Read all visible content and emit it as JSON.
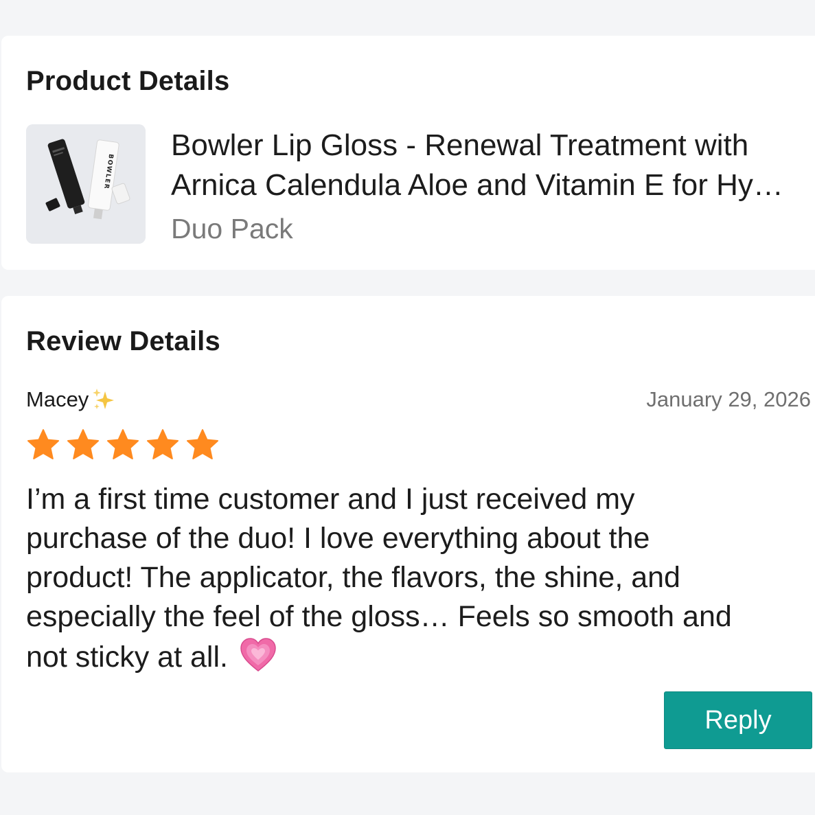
{
  "product_section": {
    "title": "Product Details",
    "product_name_line1": "Bowler Lip Gloss - Renewal Treatment with",
    "product_name_line2": "Arnica Calendula Aloe and Vitamin E for Hy…",
    "variant": "Duo Pack",
    "thumbnail_brand_text": "BOWLER"
  },
  "review_section": {
    "title": "Review Details",
    "reviewer_name": "Macey",
    "reviewer_emoji": "sparkles-icon",
    "date": "January 29, 2026",
    "rating": 5,
    "rating_max": 5,
    "body_line1": "I’m a first time customer and I just received my",
    "body_line2": "purchase of the duo! I love everything about the",
    "body_line3": "product! The applicator, the flavors, the shine, and",
    "body_line4": "especially the feel of the gloss… Feels so smooth and",
    "body_line5": "not sticky at all.",
    "body_emoji": "growing-heart-icon",
    "reply_label": "Reply"
  },
  "colors": {
    "background": "#f4f5f7",
    "card": "#ffffff",
    "star": "#ff8a1f",
    "reply_button": "#0f9b92",
    "muted_text": "#7a7a7a"
  }
}
